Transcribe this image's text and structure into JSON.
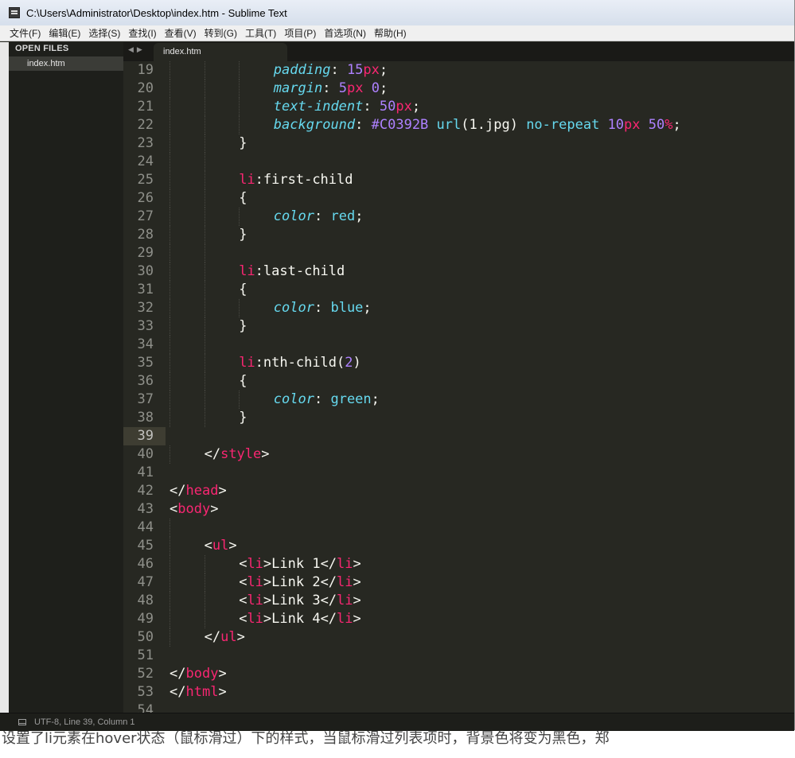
{
  "window": {
    "title": "C:\\Users\\Administrator\\Desktop\\index.htm - Sublime Text"
  },
  "menu": [
    "文件(F)",
    "编辑(E)",
    "选择(S)",
    "查找(I)",
    "查看(V)",
    "转到(G)",
    "工具(T)",
    "项目(P)",
    "首选项(N)",
    "帮助(H)"
  ],
  "sidebar": {
    "header": "OPEN FILES",
    "files": [
      "index.htm"
    ]
  },
  "tabs": [
    {
      "label": "index.htm",
      "active": true
    }
  ],
  "tab_nav": {
    "prev": "◀",
    "next": "▶"
  },
  "editor": {
    "current_line": 39,
    "lines": [
      {
        "n": "19",
        "indent": 3,
        "tokens": [
          [
            "prop",
            "padding"
          ],
          [
            "plain",
            ": "
          ],
          [
            "num",
            "15"
          ],
          [
            "unit",
            "px"
          ],
          [
            "plain",
            ";"
          ]
        ]
      },
      {
        "n": "20",
        "indent": 3,
        "tokens": [
          [
            "prop",
            "margin"
          ],
          [
            "plain",
            ": "
          ],
          [
            "num",
            "5"
          ],
          [
            "unit",
            "px"
          ],
          [
            "plain",
            " "
          ],
          [
            "num",
            "0"
          ],
          [
            "plain",
            ";"
          ]
        ]
      },
      {
        "n": "21",
        "indent": 3,
        "tokens": [
          [
            "prop",
            "text-indent"
          ],
          [
            "plain",
            ": "
          ],
          [
            "num",
            "50"
          ],
          [
            "unit",
            "px"
          ],
          [
            "plain",
            ";"
          ]
        ]
      },
      {
        "n": "22",
        "indent": 3,
        "tokens": [
          [
            "prop",
            "background"
          ],
          [
            "plain",
            ": "
          ],
          [
            "num",
            "#C0392B"
          ],
          [
            "plain",
            " "
          ],
          [
            "kw",
            "url"
          ],
          [
            "plain",
            "("
          ],
          [
            "plain",
            "1.jpg"
          ],
          [
            "plain",
            ") "
          ],
          [
            "kw",
            "no-repeat"
          ],
          [
            "plain",
            " "
          ],
          [
            "num",
            "10"
          ],
          [
            "unit",
            "px"
          ],
          [
            "plain",
            " "
          ],
          [
            "num",
            "50"
          ],
          [
            "unit",
            "%"
          ],
          [
            "plain",
            ";"
          ]
        ]
      },
      {
        "n": "23",
        "indent": 2,
        "tokens": [
          [
            "plain",
            "}"
          ]
        ]
      },
      {
        "n": "24",
        "indent": 2,
        "tokens": []
      },
      {
        "n": "25",
        "indent": 2,
        "tokens": [
          [
            "tag",
            "li"
          ],
          [
            "plain",
            ":first-child"
          ]
        ]
      },
      {
        "n": "26",
        "indent": 2,
        "tokens": [
          [
            "plain",
            "{"
          ]
        ]
      },
      {
        "n": "27",
        "indent": 3,
        "tokens": [
          [
            "prop",
            "color"
          ],
          [
            "plain",
            ": "
          ],
          [
            "kw",
            "red"
          ],
          [
            "plain",
            ";"
          ]
        ]
      },
      {
        "n": "28",
        "indent": 2,
        "tokens": [
          [
            "plain",
            "}"
          ]
        ]
      },
      {
        "n": "29",
        "indent": 2,
        "tokens": []
      },
      {
        "n": "30",
        "indent": 2,
        "tokens": [
          [
            "tag",
            "li"
          ],
          [
            "plain",
            ":last-child"
          ]
        ]
      },
      {
        "n": "31",
        "indent": 2,
        "tokens": [
          [
            "plain",
            "{"
          ]
        ]
      },
      {
        "n": "32",
        "indent": 3,
        "tokens": [
          [
            "prop",
            "color"
          ],
          [
            "plain",
            ": "
          ],
          [
            "kw",
            "blue"
          ],
          [
            "plain",
            ";"
          ]
        ]
      },
      {
        "n": "33",
        "indent": 2,
        "tokens": [
          [
            "plain",
            "}"
          ]
        ]
      },
      {
        "n": "34",
        "indent": 2,
        "tokens": []
      },
      {
        "n": "35",
        "indent": 2,
        "tokens": [
          [
            "tag",
            "li"
          ],
          [
            "plain",
            ":nth-child("
          ],
          [
            "num",
            "2"
          ],
          [
            "plain",
            ")"
          ]
        ]
      },
      {
        "n": "36",
        "indent": 2,
        "tokens": [
          [
            "plain",
            "{"
          ]
        ]
      },
      {
        "n": "37",
        "indent": 3,
        "tokens": [
          [
            "prop",
            "color"
          ],
          [
            "plain",
            ": "
          ],
          [
            "kw",
            "green"
          ],
          [
            "plain",
            ";"
          ]
        ]
      },
      {
        "n": "38",
        "indent": 2,
        "tokens": [
          [
            "plain",
            "}"
          ]
        ]
      },
      {
        "n": "39",
        "indent": 0,
        "tokens": []
      },
      {
        "n": "40",
        "indent": 1,
        "tokens": [
          [
            "plain",
            "</"
          ],
          [
            "tag",
            "style"
          ],
          [
            "plain",
            ">"
          ]
        ]
      },
      {
        "n": "41",
        "indent": 0,
        "tokens": []
      },
      {
        "n": "42",
        "indent": 0,
        "tokens": [
          [
            "plain",
            "</"
          ],
          [
            "tag",
            "head"
          ],
          [
            "plain",
            ">"
          ]
        ]
      },
      {
        "n": "43",
        "indent": 0,
        "tokens": [
          [
            "plain",
            "<"
          ],
          [
            "tag",
            "body"
          ],
          [
            "plain",
            ">"
          ]
        ]
      },
      {
        "n": "44",
        "indent": 1,
        "tokens": []
      },
      {
        "n": "45",
        "indent": 1,
        "tokens": [
          [
            "plain",
            "<"
          ],
          [
            "tag",
            "ul"
          ],
          [
            "plain",
            ">"
          ]
        ]
      },
      {
        "n": "46",
        "indent": 2,
        "tokens": [
          [
            "plain",
            "<"
          ],
          [
            "tag",
            "li"
          ],
          [
            "plain",
            ">Link 1</"
          ],
          [
            "tag",
            "li"
          ],
          [
            "plain",
            ">"
          ]
        ]
      },
      {
        "n": "47",
        "indent": 2,
        "tokens": [
          [
            "plain",
            "<"
          ],
          [
            "tag",
            "li"
          ],
          [
            "plain",
            ">Link 2</"
          ],
          [
            "tag",
            "li"
          ],
          [
            "plain",
            ">"
          ]
        ]
      },
      {
        "n": "48",
        "indent": 2,
        "tokens": [
          [
            "plain",
            "<"
          ],
          [
            "tag",
            "li"
          ],
          [
            "plain",
            ">Link 3</"
          ],
          [
            "tag",
            "li"
          ],
          [
            "plain",
            ">"
          ]
        ]
      },
      {
        "n": "49",
        "indent": 2,
        "tokens": [
          [
            "plain",
            "<"
          ],
          [
            "tag",
            "li"
          ],
          [
            "plain",
            ">Link 4</"
          ],
          [
            "tag",
            "li"
          ],
          [
            "plain",
            ">"
          ]
        ]
      },
      {
        "n": "50",
        "indent": 1,
        "tokens": [
          [
            "plain",
            "</"
          ],
          [
            "tag",
            "ul"
          ],
          [
            "plain",
            ">"
          ]
        ]
      },
      {
        "n": "51",
        "indent": 0,
        "tokens": []
      },
      {
        "n": "52",
        "indent": 0,
        "tokens": [
          [
            "plain",
            "</"
          ],
          [
            "tag",
            "body"
          ],
          [
            "plain",
            ">"
          ]
        ]
      },
      {
        "n": "53",
        "indent": 0,
        "tokens": [
          [
            "plain",
            "</"
          ],
          [
            "tag",
            "html"
          ],
          [
            "plain",
            ">"
          ]
        ]
      },
      {
        "n": "54",
        "indent": 0,
        "tokens": []
      }
    ]
  },
  "status": {
    "text": "UTF-8, Line 39, Column 1"
  },
  "page_footer": {
    "text": "设置了li元素在hover状态（鼠标滑过）下的样式，当鼠标滑过列表项时，背景色将变为黑色，郑"
  },
  "colors": {
    "editor_bg": "#272822",
    "keyword": "#66d9ef",
    "number": "#ae81ff",
    "tag": "#f92672",
    "text": "#f8f8f2",
    "gutter": "#8f908a",
    "current_line": "#3e3d32"
  }
}
